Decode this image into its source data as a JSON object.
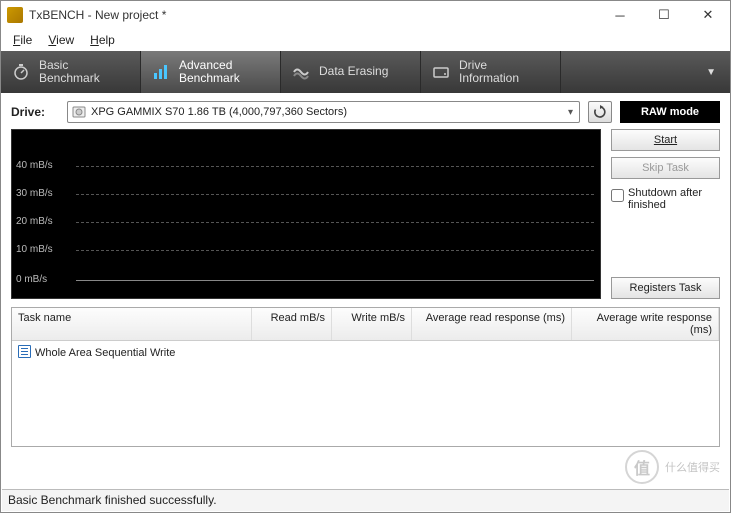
{
  "window": {
    "title": "TxBENCH - New project *"
  },
  "menu": {
    "file": "File",
    "view": "View",
    "help": "Help"
  },
  "tabs": {
    "basic": "Basic\nBenchmark",
    "advanced": "Advanced\nBenchmark",
    "erasing": "Data Erasing",
    "info": "Drive\nInformation"
  },
  "drive": {
    "label": "Drive:",
    "selected": "XPG GAMMIX S70  1.86 TB (4,000,797,360 Sectors)"
  },
  "buttons": {
    "raw": "RAW mode",
    "start": "Start",
    "skip": "Skip Task",
    "registers": "Registers Task"
  },
  "checkbox": {
    "shutdown": "Shutdown after finished"
  },
  "chart_data": {
    "type": "line",
    "title": "",
    "xlabel": "",
    "ylabel": "mB/s",
    "ylim": [
      0,
      45
    ],
    "yticks": [
      0,
      10,
      20,
      30,
      40
    ],
    "ytick_labels": [
      "0 mB/s",
      "10 mB/s",
      "20 mB/s",
      "30 mB/s",
      "40 mB/s"
    ],
    "series": [],
    "note": "no data plotted"
  },
  "table": {
    "headers": {
      "task": "Task name",
      "read": "Read mB/s",
      "write": "Write mB/s",
      "avgread": "Average read response (ms)",
      "avgwrite": "Average write response (ms)"
    },
    "rows": [
      {
        "task": "Whole Area Sequential Write",
        "read": "",
        "write": "",
        "avgread": "",
        "avgwrite": ""
      }
    ]
  },
  "status": "Basic Benchmark finished successfully.",
  "watermark": {
    "glyph": "值",
    "text": "什么值得买"
  }
}
